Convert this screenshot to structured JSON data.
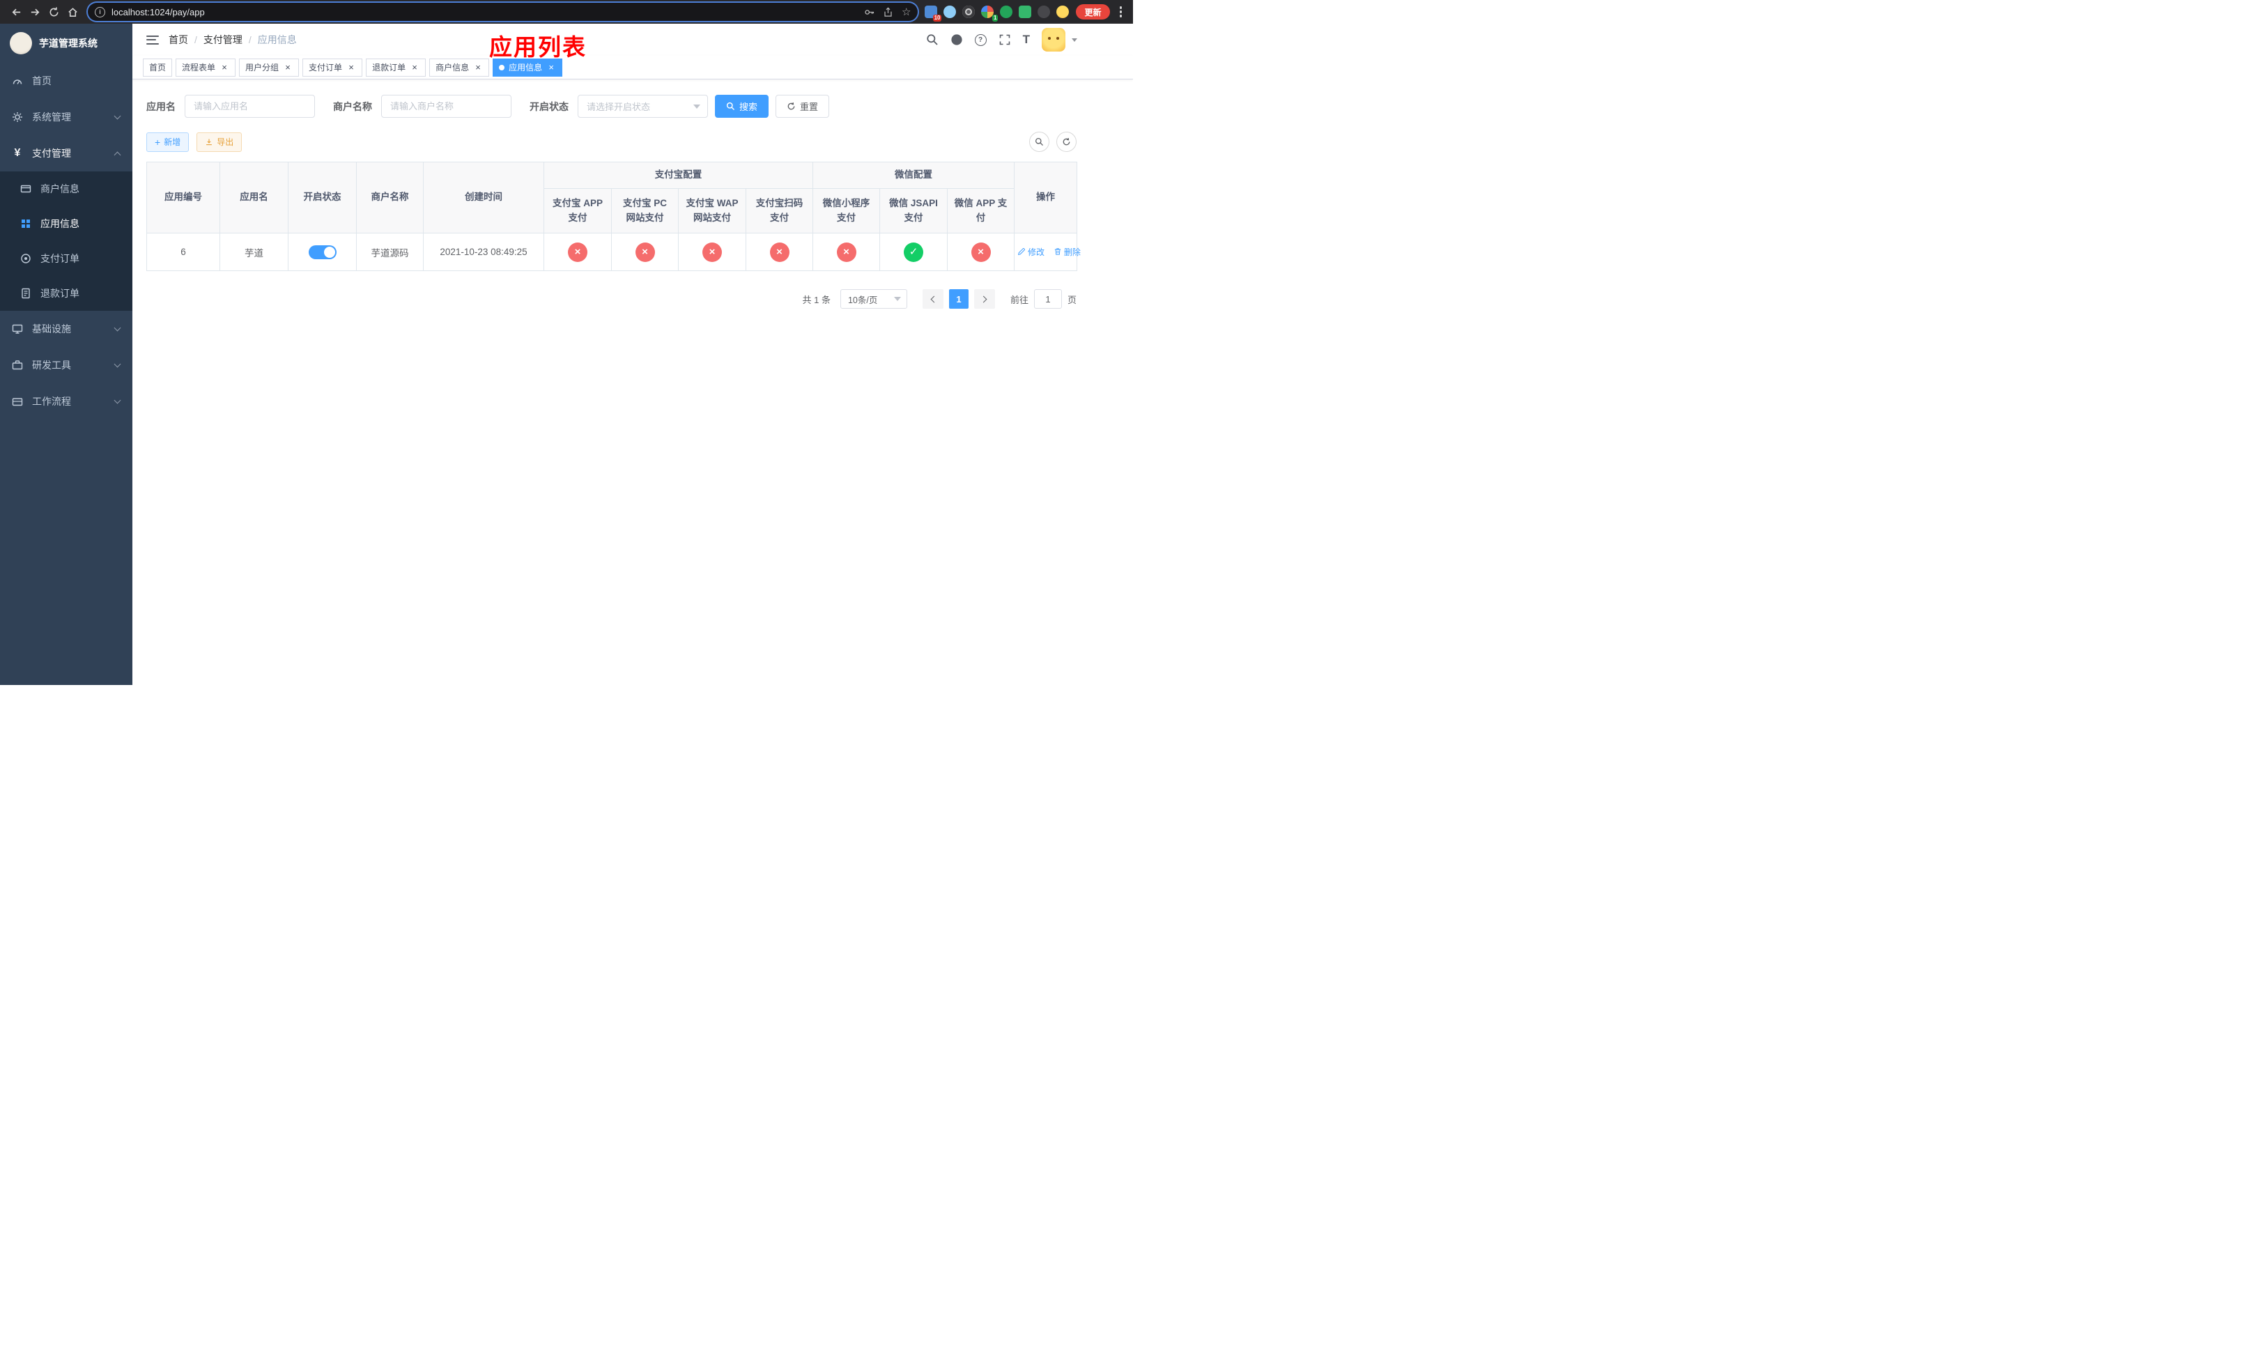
{
  "browser": {
    "url": "localhost:1024/pay/app",
    "update_button": "更新",
    "ext_badges": [
      "10",
      "1"
    ]
  },
  "app": {
    "title": "芋道管理系统"
  },
  "sidebar": {
    "items": [
      {
        "label": "首页"
      },
      {
        "label": "系统管理"
      },
      {
        "label": "支付管理",
        "children": [
          {
            "label": "商户信息"
          },
          {
            "label": "应用信息"
          },
          {
            "label": "支付订单"
          },
          {
            "label": "退款订单"
          }
        ]
      },
      {
        "label": "基础设施"
      },
      {
        "label": "研发工具"
      },
      {
        "label": "工作流程"
      }
    ]
  },
  "header": {
    "breadcrumb": [
      "首页",
      "支付管理",
      "应用信息"
    ],
    "breadcrumb_separator": "/",
    "overlay_title": "应用列表"
  },
  "tabs": [
    {
      "label": "首页"
    },
    {
      "label": "流程表单"
    },
    {
      "label": "用户分组"
    },
    {
      "label": "支付订单"
    },
    {
      "label": "退款订单"
    },
    {
      "label": "商户信息"
    },
    {
      "label": "应用信息"
    }
  ],
  "filters": {
    "app_name_label": "应用名",
    "app_name_placeholder": "请输入应用名",
    "merchant_label": "商户名称",
    "merchant_placeholder": "请输入商户名称",
    "status_label": "开启状态",
    "status_placeholder": "请选择开启状态",
    "search_button": "搜索",
    "reset_button": "重置"
  },
  "toolbar": {
    "add_button": "新增",
    "export_button": "导出"
  },
  "table": {
    "simple_columns": [
      "应用编号",
      "应用名",
      "开启状态",
      "商户名称",
      "创建时间"
    ],
    "group_columns": [
      {
        "label": "支付宝配置",
        "children": [
          "支付宝 APP 支付",
          "支付宝 PC 网站支付",
          "支付宝 WAP 网站支付",
          "支付宝扫码支付"
        ]
      },
      {
        "label": "微信配置",
        "children": [
          "微信小程序支付",
          "微信 JSAPI 支付",
          "微信 APP 支付"
        ]
      }
    ],
    "action_column": "操作",
    "rows": [
      {
        "app_id": "6",
        "app_name": "芋道",
        "status_on": true,
        "merchant_name": "芋道源码",
        "create_time": "2021-10-23 08:49:25",
        "configs": [
          "no",
          "no",
          "no",
          "no",
          "no",
          "yes",
          "no"
        ],
        "edit_label": "修改",
        "delete_label": "删除"
      }
    ]
  },
  "pagination": {
    "total": "共 1 条",
    "page_size": "10条/页",
    "page": "1",
    "goto_prefix": "前往",
    "goto_value": "1",
    "goto_suffix": "页"
  },
  "icons": {
    "check": "✓",
    "cross": "×",
    "close": "×",
    "plus": "+",
    "yen": "¥",
    "question": "?",
    "font_size": "T",
    "star": "☆",
    "info": "i"
  },
  "colors": {
    "primary": "#409eff",
    "success": "#13ce66",
    "danger": "#f56c6c",
    "warning": "#e6a23c",
    "sidebar_bg": "#304156",
    "submenu_bg": "#1f2d3d",
    "title_red": "#ff0000"
  }
}
